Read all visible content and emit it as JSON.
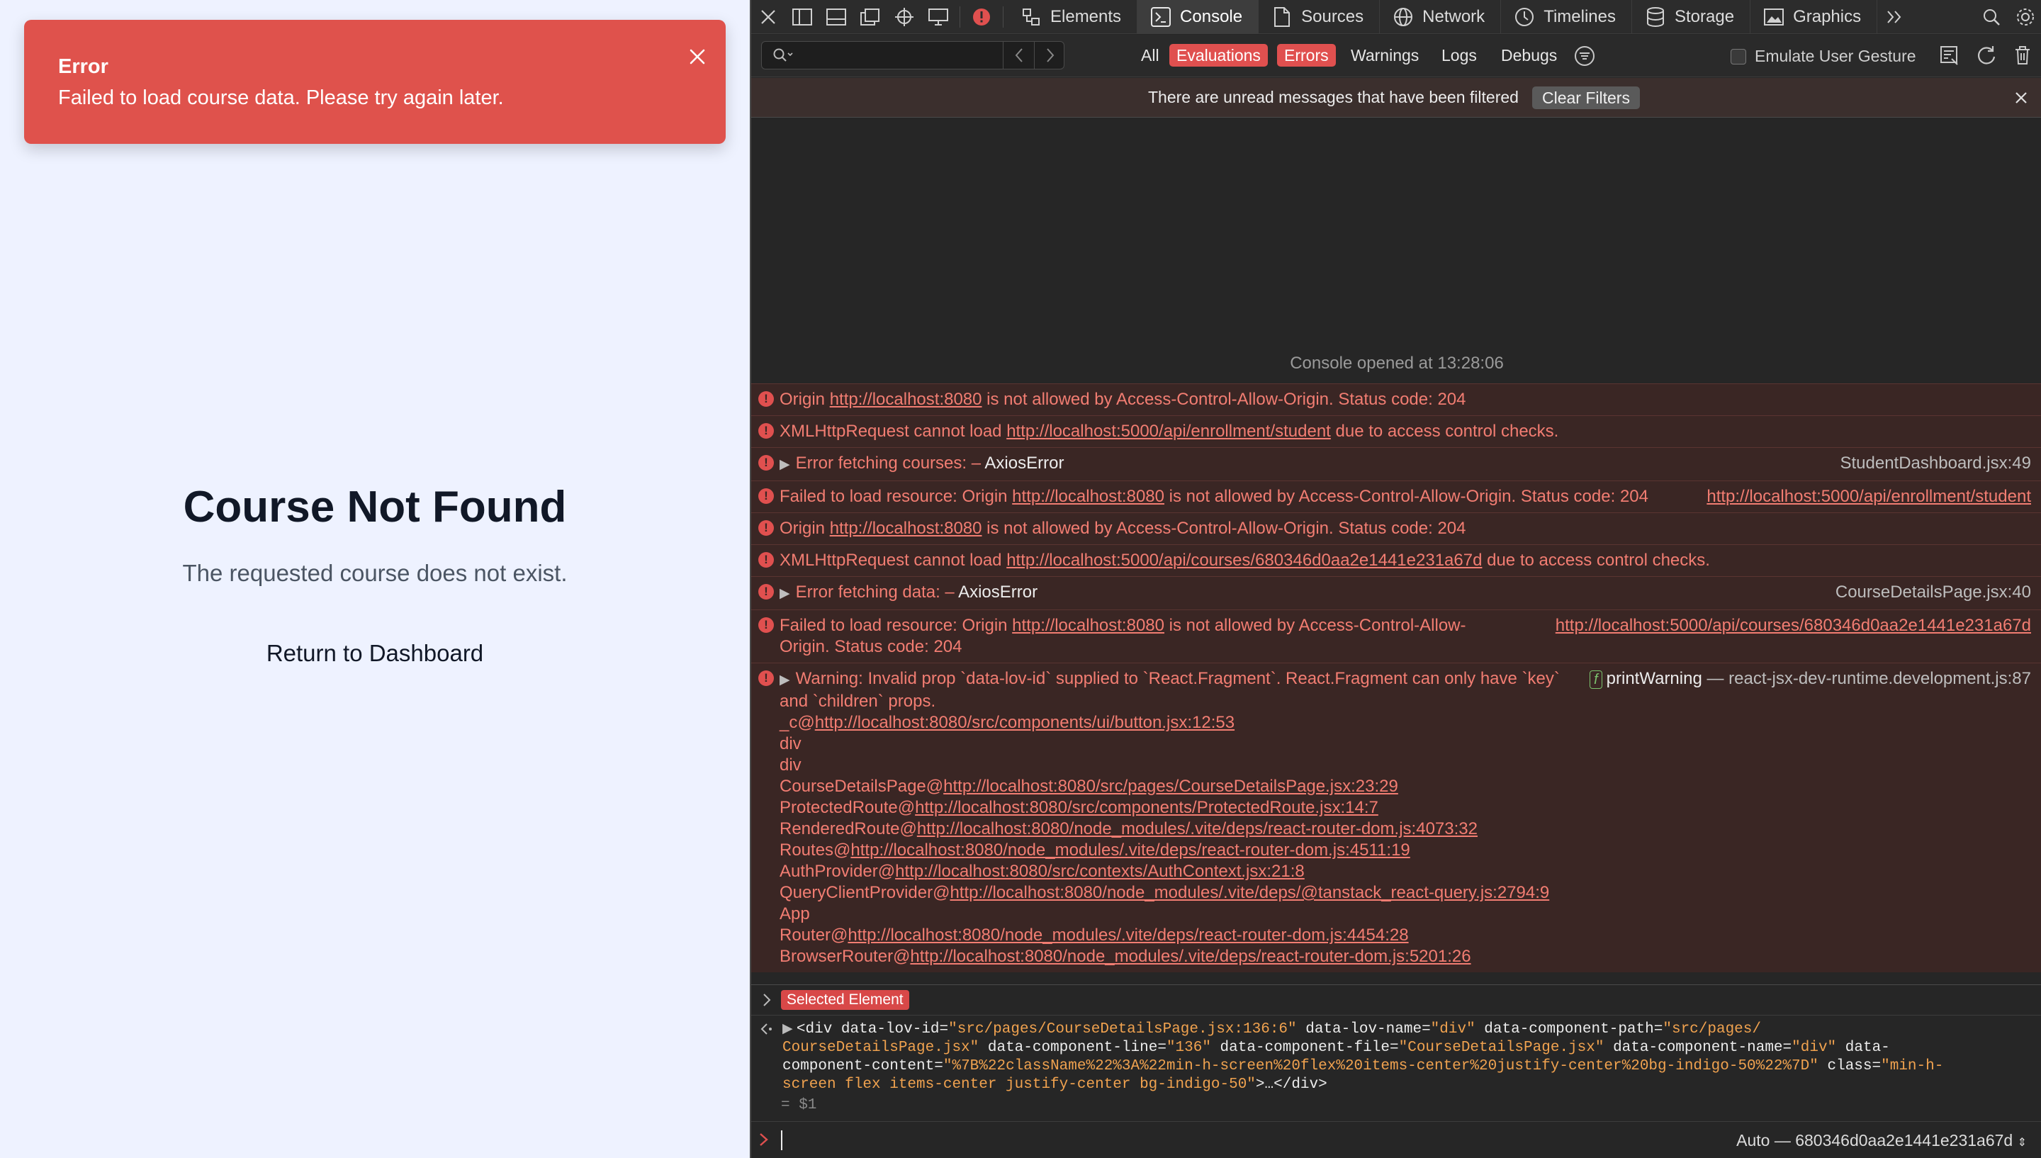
{
  "app": {
    "toast": {
      "title": "Error",
      "message": "Failed to load course data. Please try again later.",
      "color": "#df524c"
    },
    "not_found": {
      "title": "Course Not Found",
      "message": "The requested course does not exist.",
      "button": "Return to Dashboard"
    }
  },
  "devtools": {
    "tabs": [
      {
        "label": "Elements",
        "icon": "elements-icon"
      },
      {
        "label": "Console",
        "icon": "console-icon",
        "active": true
      },
      {
        "label": "Sources",
        "icon": "sources-icon"
      },
      {
        "label": "Network",
        "icon": "network-icon"
      },
      {
        "label": "Timelines",
        "icon": "timelines-icon"
      },
      {
        "label": "Storage",
        "icon": "storage-icon"
      },
      {
        "label": "Graphics",
        "icon": "graphics-icon"
      }
    ],
    "filters": {
      "all": "All",
      "evaluations": "Evaluations",
      "errors": "Errors",
      "warnings": "Warnings",
      "logs": "Logs",
      "debugs": "Debugs",
      "emulate": "Emulate User Gesture"
    },
    "banner": {
      "text": "There are unread messages that have been filtered",
      "button": "Clear Filters"
    },
    "opened": "Console opened at 13:28:06",
    "messages": {
      "m1": {
        "pre": "Origin ",
        "link": "http://localhost:8080",
        "post": " is not allowed by Access-Control-Allow-Origin. Status code: 204"
      },
      "m2": {
        "pre": "XMLHttpRequest cannot load ",
        "link": "http://localhost:5000/api/enrollment/student",
        "post": " due to access control checks."
      },
      "m3": {
        "pre": "Error fetching courses: – ",
        "obj": "AxiosError",
        "source": "StudentDashboard.jsx:49"
      },
      "m4": {
        "pre": "Failed to load resource: Origin ",
        "link": "http://localhost:8080",
        "post": " is not allowed by Access-Control-Allow-Origin. Status code: 204",
        "source": "http://localhost:5000/api/enrollment/student"
      },
      "m5": {
        "pre": "Origin ",
        "link": "http://localhost:8080",
        "post": " is not allowed by Access-Control-Allow-Origin. Status code: 204"
      },
      "m6": {
        "pre": "XMLHttpRequest cannot load ",
        "link": "http://localhost:5000/api/courses/680346d0aa2e1441e231a67d",
        "post": " due to access control checks."
      },
      "m7": {
        "pre": "Error fetching data: – ",
        "obj": "AxiosError",
        "source": "CourseDetailsPage.jsx:40"
      },
      "m8": {
        "pre": "Failed to load resource: Origin ",
        "link": "http://localhost:8080",
        "post": " is not allowed by Access-Control-Allow-Origin. Status code: 204",
        "source": "http://localhost:5000/api/courses/680346d0aa2e1441e231a67d"
      },
      "m9": {
        "text": "Warning: Invalid prop `data-lov-id` supplied to `React.Fragment`. React.Fragment can only have `key` and `children` props.",
        "fn_badge": "f",
        "fn": "printWarning",
        "source": "— react-jsx-dev-runtime.development.js:87",
        "stack": [
          {
            "pre": "_c@",
            "link": "http://localhost:8080/src/components/ui/button.jsx:12:53"
          },
          {
            "pre": "div",
            "link": ""
          },
          {
            "pre": "div",
            "link": ""
          },
          {
            "pre": "CourseDetailsPage@",
            "link": "http://localhost:8080/src/pages/CourseDetailsPage.jsx:23:29"
          },
          {
            "pre": "ProtectedRoute@",
            "link": "http://localhost:8080/src/components/ProtectedRoute.jsx:14:7"
          },
          {
            "pre": "RenderedRoute@",
            "link": "http://localhost:8080/node_modules/.vite/deps/react-router-dom.js:4073:32"
          },
          {
            "pre": "Routes@",
            "link": "http://localhost:8080/node_modules/.vite/deps/react-router-dom.js:4511:19"
          },
          {
            "pre": "AuthProvider@",
            "link": "http://localhost:8080/src/contexts/AuthContext.jsx:21:8"
          },
          {
            "pre": "QueryClientProvider@",
            "link": "http://localhost:8080/node_modules/.vite/deps/@tanstack_react-query.js:2794:9"
          },
          {
            "pre": "App",
            "link": ""
          },
          {
            "pre": "Router@",
            "link": "http://localhost:8080/node_modules/.vite/deps/react-router-dom.js:4454:28"
          },
          {
            "pre": "BrowserRouter@",
            "link": "http://localhost:8080/node_modules/.vite/deps/react-router-dom.js:5201:26"
          }
        ]
      }
    },
    "selected_element": "Selected Element",
    "eval": {
      "a1n": "data-lov-id",
      "a1v": "\"src/pages/CourseDetailsPage.jsx:136:6\"",
      "a2n": "data-lov-name",
      "a2v": "\"div\"",
      "a3n": "data-component-path",
      "a3v": "\"src/pages/",
      "a3v2": "CourseDetailsPage.jsx\"",
      "a4n": "data-component-line",
      "a4v": "\"136\"",
      "a5n": "data-component-file",
      "a5v": "\"CourseDetailsPage.jsx\"",
      "a6n": "data-component-name",
      "a6v": "\"div\"",
      "a7n": "data-",
      "a7n2": "component-content",
      "a7v": "\"%7B%22className%22%3A%22min-h-screen%20flex%20items-center%20justify-center%20bg-indigo-50%22%7D\"",
      "a8n": "class",
      "a8v": "\"min-h-",
      "a8v2": "screen flex items-center justify-center bg-indigo-50\"",
      "result": "= $1"
    },
    "context": "Auto — 680346d0aa2e1441e231a67d",
    "colors": {
      "error_text": "#f27d72",
      "error_bg": "#3a2624",
      "badge": "#e0504f"
    }
  }
}
